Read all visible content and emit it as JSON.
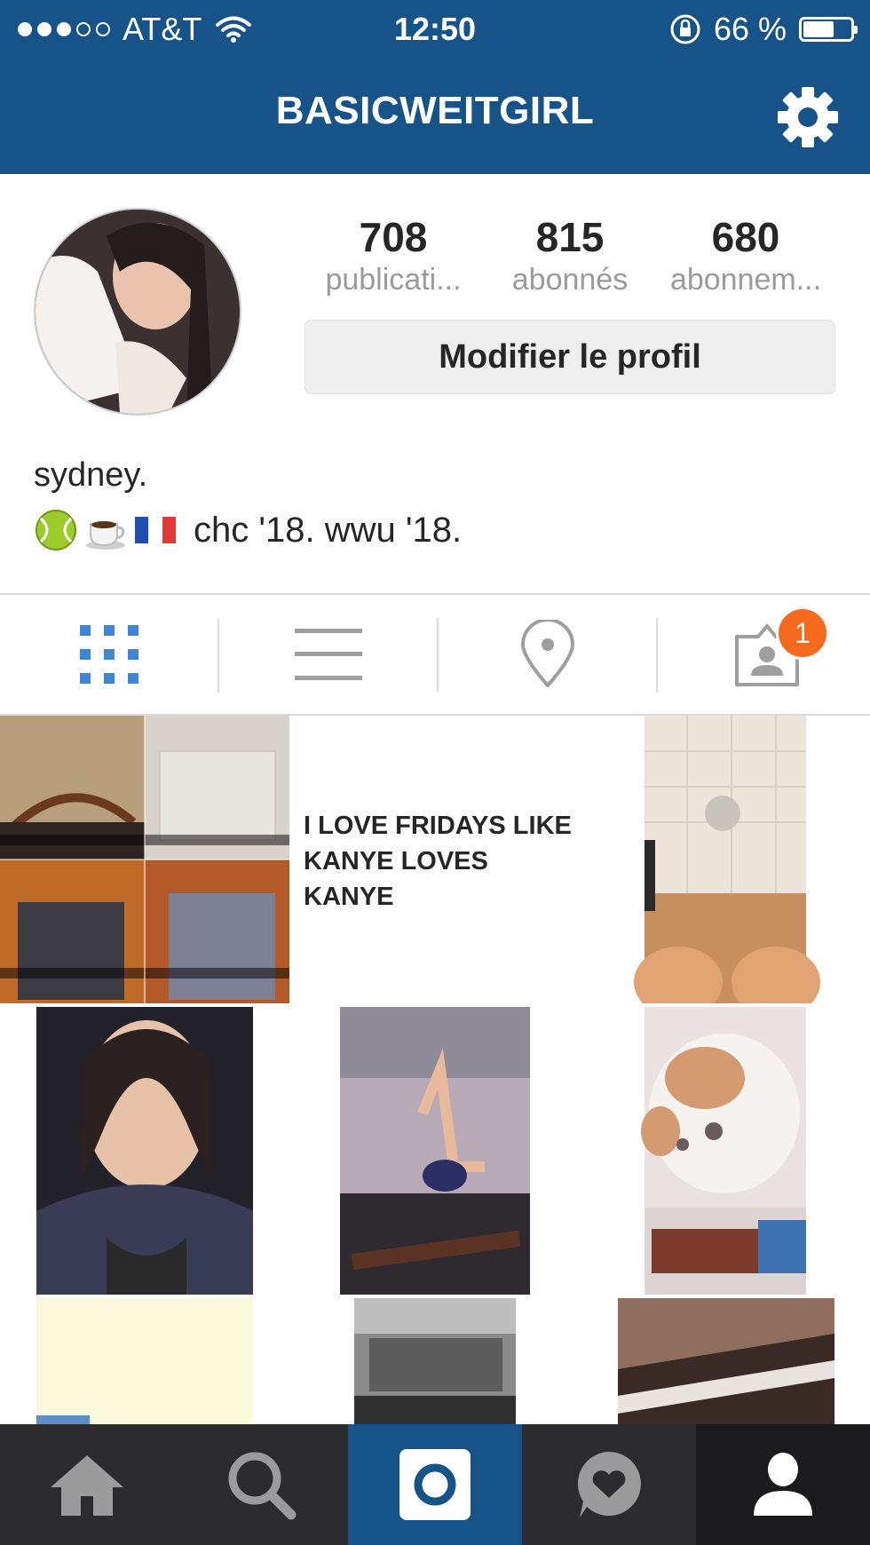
{
  "status_bar": {
    "carrier": "AT&T",
    "signal_dots_full": 3,
    "signal_dots_empty": 2,
    "time": "12:50",
    "battery_text": "66 %",
    "battery_level": 0.66
  },
  "header": {
    "username": "BASICWEITGIRL",
    "settings_icon": "gear-icon"
  },
  "profile": {
    "stats": [
      {
        "value": "708",
        "label": "publicati..."
      },
      {
        "value": "815",
        "label": "abonnés"
      },
      {
        "value": "680",
        "label": "abonnem..."
      }
    ],
    "edit_label": "Modifier le profil",
    "name": "sydney.",
    "bio_text": "chc '18. wwu '18.",
    "bio_emojis": [
      "tennis-ball-emoji",
      "coffee-emoji",
      "french-flag-emoji"
    ]
  },
  "tabs": [
    {
      "icon": "grid-icon",
      "active": true
    },
    {
      "icon": "list-icon",
      "active": false
    },
    {
      "icon": "location-pin-icon",
      "active": false
    },
    {
      "icon": "tagged-photos-icon",
      "active": false,
      "badge": "1"
    }
  ],
  "posts": {
    "text_post_lines": [
      "I LOVE FRIDAYS LIKE",
      "KANYE LOVES KANYE"
    ]
  },
  "colors": {
    "header_bg": "#165388",
    "accent": "#3f85d6",
    "badge": "#f56a1c",
    "tabbar_bg": "#2c2c2e"
  },
  "tabbar": [
    {
      "icon": "home-icon",
      "active": false
    },
    {
      "icon": "search-icon",
      "active": false
    },
    {
      "icon": "camera-icon",
      "active": false
    },
    {
      "icon": "activity-heart-icon",
      "active": false
    },
    {
      "icon": "profile-icon",
      "active": true
    }
  ]
}
